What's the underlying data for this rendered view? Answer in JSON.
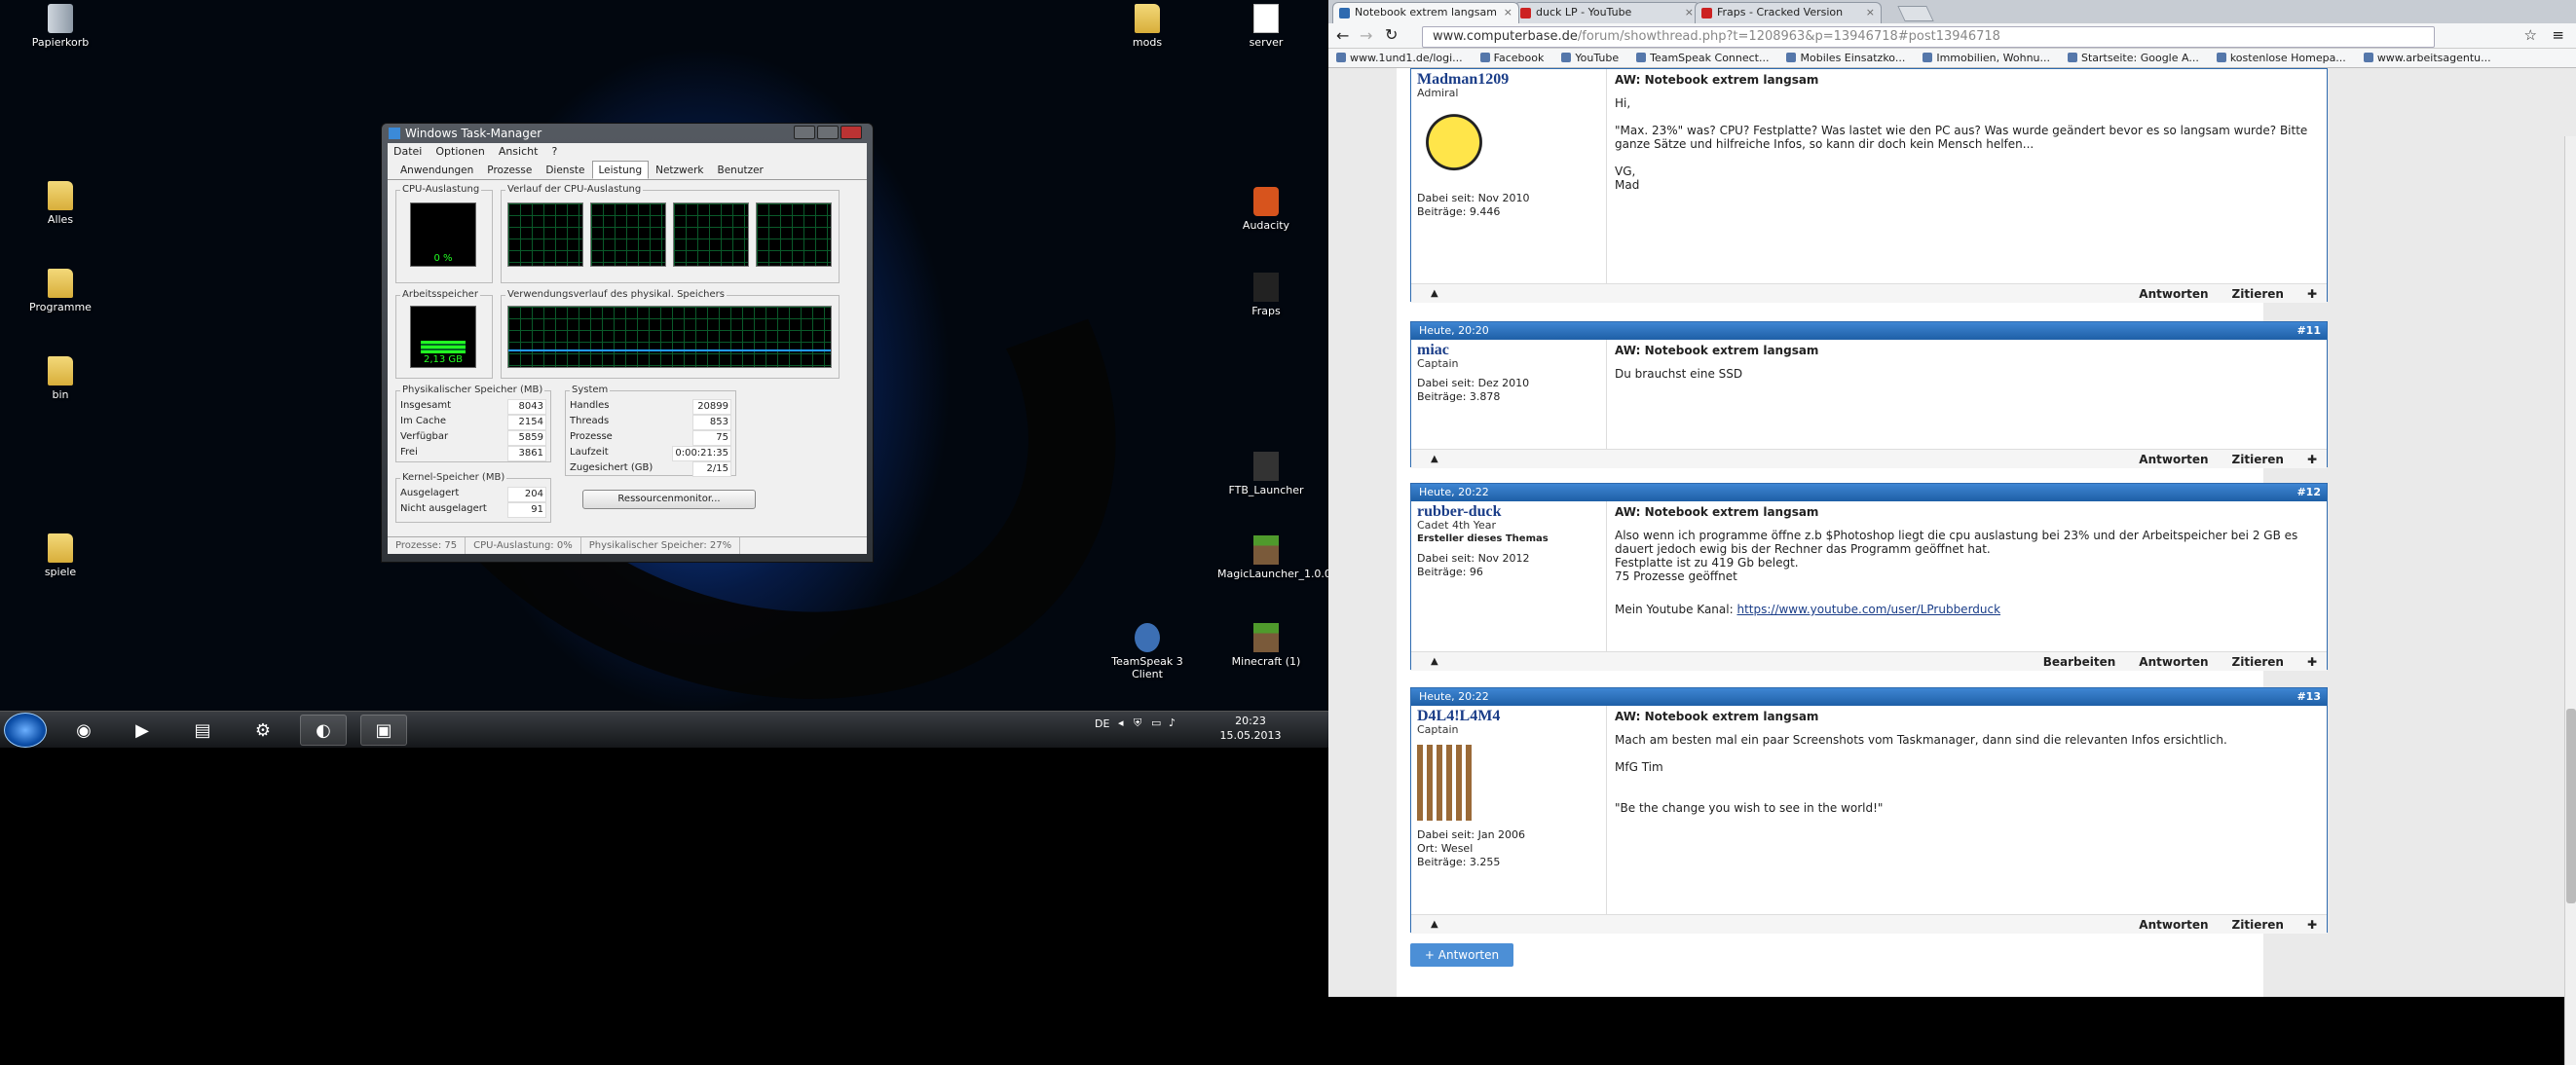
{
  "desktop": {
    "icons": [
      {
        "label": "Papierkorb",
        "kind": "bin"
      },
      {
        "label": "Alles",
        "kind": "folder"
      },
      {
        "label": "Programme",
        "kind": "folder"
      },
      {
        "label": "bin",
        "kind": "folder"
      },
      {
        "label": "spiele",
        "kind": "folder"
      },
      {
        "label": "mods",
        "kind": "folder"
      },
      {
        "label": "server",
        "kind": "paper"
      },
      {
        "label": "Audacity",
        "kind": "aud"
      },
      {
        "label": "Fraps",
        "kind": "fraps"
      },
      {
        "label": "FTB_Launcher",
        "kind": "ftb"
      },
      {
        "label": "MagicLauncher_1.0.0",
        "kind": "mc"
      },
      {
        "label": "Minecraft (1)",
        "kind": "mc"
      },
      {
        "label": "TeamSpeak 3 Client",
        "kind": "tsk"
      }
    ]
  },
  "taskbar": {
    "lang": "DE",
    "time": "20:23",
    "date": "15.05.2013"
  },
  "taskmanager": {
    "title": "Windows Task-Manager",
    "menu": [
      "Datei",
      "Optionen",
      "Ansicht",
      "?"
    ],
    "tabs": [
      "Anwendungen",
      "Prozesse",
      "Dienste",
      "Leistung",
      "Netzwerk",
      "Benutzer"
    ],
    "cpu_label": "CPU-Auslastung",
    "cpu_value": "0 %",
    "cpu_fraction": 0.0,
    "cpu_history_label": "Verlauf der CPU-Auslastung",
    "mem_label": "Arbeitsspeicher",
    "mem_value": "2,13 GB",
    "mem_fraction": 0.27,
    "mem_history_label": "Verwendungsverlauf des physikal. Speichers",
    "phys_label": "Physikalischer Speicher (MB)",
    "phys": [
      [
        "Insgesamt",
        "8043"
      ],
      [
        "Im Cache",
        "2154"
      ],
      [
        "Verfügbar",
        "5859"
      ],
      [
        "Frei",
        "3861"
      ]
    ],
    "sys_label": "System",
    "sys": [
      [
        "Handles",
        "20899"
      ],
      [
        "Threads",
        "853"
      ],
      [
        "Prozesse",
        "75"
      ],
      [
        "Laufzeit",
        "0:00:21:35"
      ],
      [
        "Zugesichert (GB)",
        "2/15"
      ]
    ],
    "kernel_label": "Kernel-Speicher (MB)",
    "kernel": [
      [
        "Ausgelagert",
        "204"
      ],
      [
        "Nicht ausgelagert",
        "91"
      ]
    ],
    "resmon": "Ressourcenmonitor...",
    "status": [
      "Prozesse: 75",
      "CPU-Auslastung: 0%",
      "Physikalischer Speicher: 27%"
    ]
  },
  "browser": {
    "tabs": [
      {
        "label": "Notebook extrem langsam",
        "color": "#2e6bb0"
      },
      {
        "label": "duck LP - YouTube",
        "color": "#cc2222"
      },
      {
        "label": "Fraps - Cracked Version",
        "color": "#cc2222"
      }
    ],
    "url_host": "www.computerbase.de",
    "url_path": "/forum/showthread.php?t=1208963&p=13946718#post13946718",
    "bookmarks": [
      "www.1und1.de/logi...",
      "Facebook",
      "YouTube",
      "TeamSpeak Connect...",
      "Mobiles Einsatzko...",
      "Immobilien, Wohnu...",
      "Startseite: Google A...",
      "kostenlose Homepa...",
      "www.arbeitsagentu..."
    ]
  },
  "actions": {
    "reply": "Antworten",
    "quote": "Zitieren",
    "edit": "Bearbeiten",
    "reply_button": "+ Antworten"
  },
  "posts": [
    {
      "header": "",
      "num": "",
      "user": "Madman1209",
      "rank": "Admiral",
      "extra": "",
      "since": "Dabei seit: Nov 2010",
      "count": "Beiträge: 9.446",
      "place": "",
      "subject": "AW: Notebook extrem langsam",
      "lines": [
        "Hi,",
        "",
        "\"Max. 23%\" was? CPU? Festplatte? Was lastet wie den PC aus? Was wurde geändert bevor es so langsam wurde? Bitte ganze Sätze und hilfreiche Infos, so kann dir doch kein Mensch helfen...",
        "",
        "VG,",
        "Mad"
      ],
      "link_label": "",
      "link": "",
      "edit": false
    },
    {
      "header": "Heute, 20:20",
      "num": "#11",
      "user": "miac",
      "rank": "Captain",
      "extra": "",
      "since": "Dabei seit: Dez 2010",
      "count": "Beiträge: 3.878",
      "place": "",
      "subject": "AW: Notebook extrem langsam",
      "lines": [
        "Du brauchst eine SSD"
      ],
      "link_label": "",
      "link": "",
      "edit": false
    },
    {
      "header": "Heute, 20:22",
      "num": "#12",
      "user": "rubber-duck",
      "rank": "Cadet 4th Year",
      "extra": "Ersteller dieses Themas",
      "since": "Dabei seit: Nov 2012",
      "count": "Beiträge: 96",
      "place": "",
      "subject": "AW: Notebook extrem langsam",
      "lines": [
        "Also wenn ich programme öffne z.b $Photoshop liegt die cpu auslastung bei 23% und der Arbeitspeicher bei 2 GB es dauert jedoch ewig bis der Rechner das Programm geöffnet hat.",
        "Festplatte ist zu 419 Gb belegt.",
        "75 Prozesse geöffnet"
      ],
      "link_label": "Mein Youtube Kanal: ",
      "link": "https://www.youtube.com/user/LPrubberduck",
      "edit": true
    },
    {
      "header": "Heute, 20:22",
      "num": "#13",
      "user": "D4L4!L4M4",
      "rank": "Captain",
      "extra": "",
      "since": "Dabei seit: Jan 2006",
      "count": "Beiträge: 3.255",
      "place": "Ort: Wesel",
      "subject": "AW: Notebook extrem langsam",
      "lines": [
        "Mach am besten mal ein paar Screenshots vom Taskmanager, dann sind die relevanten Infos ersichtlich.",
        "",
        "MfG Tim",
        "",
        "",
        "\"Be the change you wish to see in the world!\""
      ],
      "link_label": "",
      "link": "",
      "edit": false
    }
  ]
}
